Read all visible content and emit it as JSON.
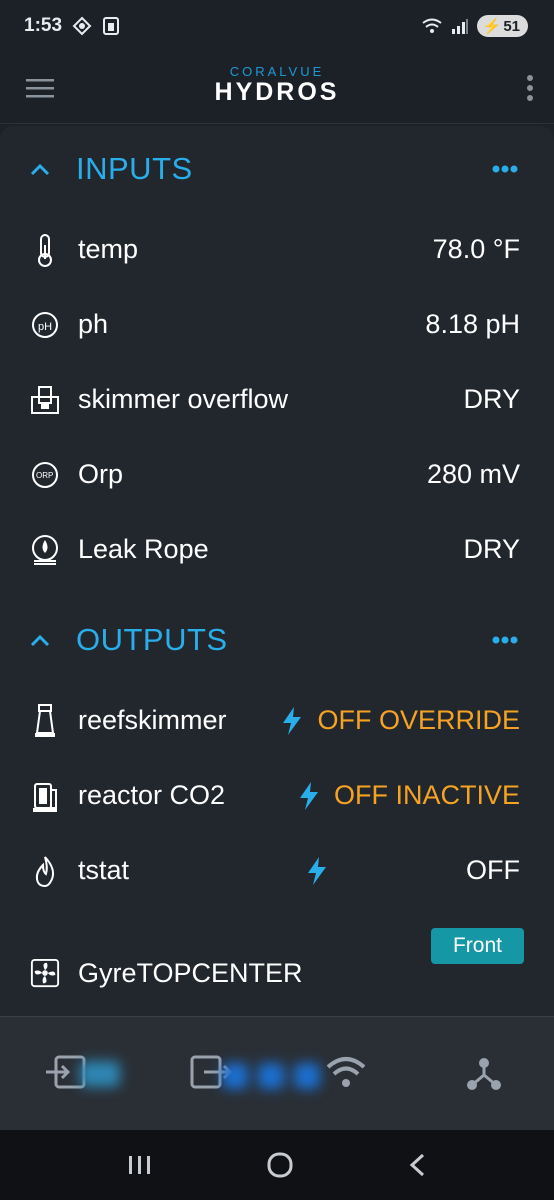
{
  "status_bar": {
    "time": "1:53",
    "battery": "51"
  },
  "app": {
    "brand_top": "CORALVUE",
    "brand_name": "HYDROS"
  },
  "inputs": {
    "title": "INPUTS",
    "rows": [
      {
        "label": "temp",
        "value": "78.0 °F",
        "icon": "thermometer-icon"
      },
      {
        "label": "ph",
        "value": "8.18 pH",
        "icon": "ph-probe-icon"
      },
      {
        "label": "skimmer overflow",
        "value": "DRY",
        "icon": "skimmer-overflow-icon"
      },
      {
        "label": "Orp",
        "value": "280 mV",
        "icon": "orp-probe-icon"
      },
      {
        "label": "Leak Rope",
        "value": "DRY",
        "icon": "leak-rope-icon"
      }
    ]
  },
  "outputs": {
    "title": "OUTPUTS",
    "rows": [
      {
        "label": "reefskimmer",
        "value": "OFF OVERRIDE",
        "icon": "skimmer-icon"
      },
      {
        "label": "reactor CO2",
        "value": "OFF INACTIVE",
        "icon": "reactor-icon"
      },
      {
        "label": "tstat",
        "value": "OFF",
        "icon": "flame-icon"
      },
      {
        "label": "GyreTOPCENTER",
        "button": "Front",
        "icon": "fan-icon"
      }
    ]
  },
  "colors": {
    "accent": "#29aee9",
    "warning": "#f6a323",
    "button": "#1697a5"
  }
}
